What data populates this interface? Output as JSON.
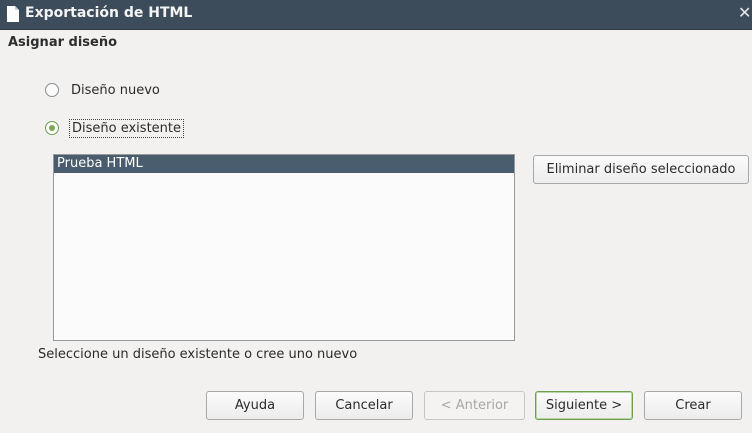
{
  "titlebar": {
    "title": "Exportación de HTML",
    "close_label": "✕"
  },
  "section": {
    "title": "Asignar diseño"
  },
  "options": [
    {
      "label": "Diseño nuevo",
      "checked": false
    },
    {
      "label": "Diseño existente",
      "checked": true
    }
  ],
  "designs": {
    "items": [
      {
        "label": "Prueba HTML",
        "selected": true
      }
    ]
  },
  "delete_button": {
    "label": "Eliminar diseño seleccionado"
  },
  "hint": "Seleccione un diseño existente o cree uno nuevo",
  "buttons": {
    "help": "Ayuda",
    "cancel": "Cancelar",
    "back": "< Anterior",
    "next": "Siguiente >",
    "create": "Crear"
  },
  "colors": {
    "titlebar": "#3c4c5a",
    "selection": "#4a5d6e",
    "accent": "#78a958"
  },
  "icons": {
    "window": "document-icon",
    "close": "close-icon"
  }
}
